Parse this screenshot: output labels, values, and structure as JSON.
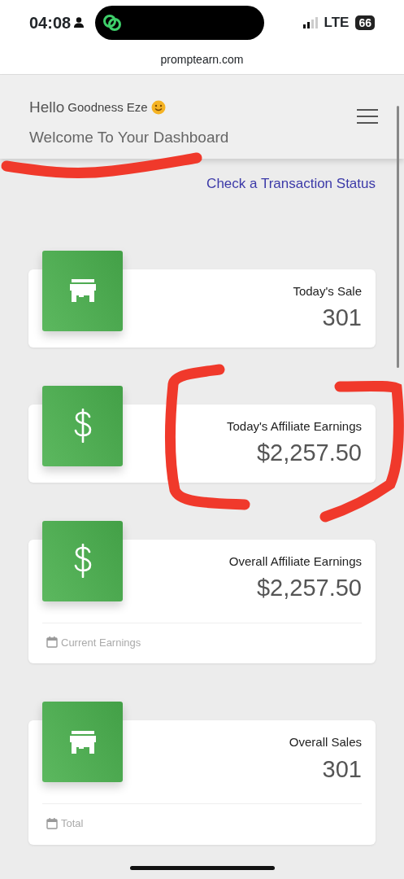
{
  "status_bar": {
    "time": "04:08",
    "network": "LTE",
    "battery": "66"
  },
  "address_bar": {
    "url": "promptearn.com"
  },
  "header": {
    "greeting": "Hello",
    "user_name": "Goodness Eze",
    "subtitle": "Welcome To Your Dashboard"
  },
  "transaction_link": "Check a Transaction Status",
  "stat_cards": [
    {
      "kind": "store",
      "title": "Today's Sale",
      "value": "301"
    },
    {
      "kind": "dollar",
      "title": "Today's Affiliate Earnings",
      "value": "$2,257.50"
    },
    {
      "kind": "dollar",
      "title": "Overall Affiliate Earnings",
      "value": "$2,257.50",
      "footer": "Current Earnings"
    },
    {
      "kind": "store",
      "title": "Overall Sales",
      "value": "301",
      "footer": "Total"
    }
  ],
  "markup": [
    {
      "kind": "underline"
    },
    {
      "kind": "left-bracket"
    },
    {
      "kind": "right-bracket"
    }
  ]
}
